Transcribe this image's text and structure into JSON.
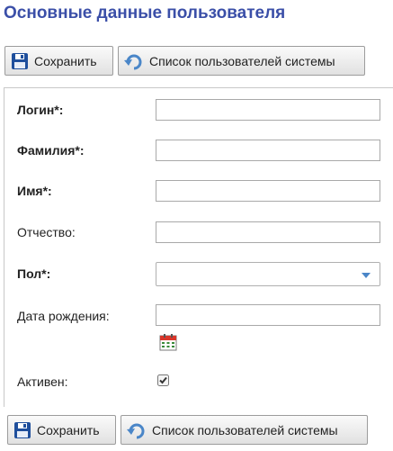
{
  "header": {
    "title": "Основные данные пользователя"
  },
  "toolbar": {
    "save_label": "Сохранить",
    "list_label": "Список пользователей системы"
  },
  "form": {
    "login": {
      "label": "Логин*:",
      "value": ""
    },
    "surname": {
      "label": "Фамилия*:",
      "value": ""
    },
    "name": {
      "label": "Имя*:",
      "value": ""
    },
    "patronymic": {
      "label": "Отчество:",
      "value": ""
    },
    "gender": {
      "label": "Пол*:",
      "selected": ""
    },
    "birthdate": {
      "label": "Дата рождения:",
      "value": ""
    },
    "active": {
      "label": "Активен:",
      "checked": true
    }
  },
  "icons": {
    "save": "floppy-disk-icon",
    "list": "refresh-arrow-icon",
    "calendar": "calendar-icon",
    "dropdown": "chevron-down-icon"
  },
  "colors": {
    "title": "#3b4fa8",
    "floppy": "#1f4f9c",
    "arrow": "#4a86c8"
  }
}
